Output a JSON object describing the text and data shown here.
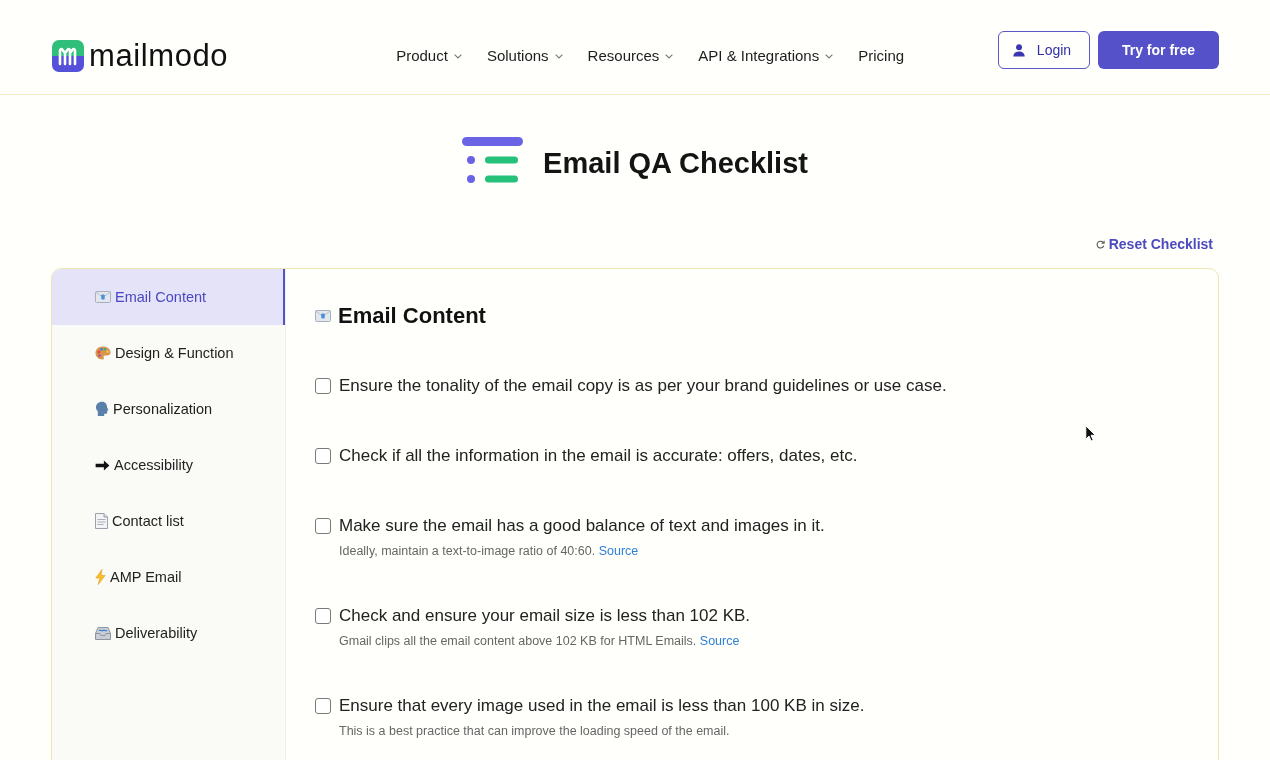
{
  "header": {
    "logo": "mailmodo",
    "nav": [
      {
        "label": "Product",
        "dropdown": true
      },
      {
        "label": "Solutions",
        "dropdown": true
      },
      {
        "label": "Resources",
        "dropdown": true
      },
      {
        "label": "API & Integrations",
        "dropdown": true
      },
      {
        "label": "Pricing",
        "dropdown": false
      }
    ],
    "login_button": "Login",
    "cta_button": "Try for free"
  },
  "page_title": "Email QA Checklist",
  "reset_link": "Reset Checklist",
  "sidebar": {
    "items": [
      {
        "label": "Email Content",
        "selected": true
      },
      {
        "label": "Design & Function",
        "selected": false
      },
      {
        "label": "Personalization",
        "selected": false
      },
      {
        "label": "Accessibility",
        "selected": false
      },
      {
        "label": "Contact list",
        "selected": false
      },
      {
        "label": "AMP Email",
        "selected": false
      },
      {
        "label": "Deliverability",
        "selected": false
      }
    ]
  },
  "section": {
    "heading": "Email Content",
    "items": [
      {
        "text": "Ensure the tonality of the email copy is as per your brand guidelines or use case.",
        "checked": false
      },
      {
        "text": "Check if all the information in the email is accurate: offers, dates, etc.",
        "checked": false
      },
      {
        "text": "Make sure the email has a good balance of text and images in it.",
        "checked": false,
        "note": "Ideally, maintain a text-to-image ratio of 40:60.",
        "note_link": "Source"
      },
      {
        "text": "Check and ensure your email size is less than 102 KB.",
        "checked": false,
        "note": "Gmail clips all the email content above 102 KB for HTML Emails.",
        "note_link": "Source"
      },
      {
        "text": "Ensure that every image used in the email is less than 100 KB in size.",
        "checked": false,
        "note": "This is a best practice that can improve the loading speed of the email."
      }
    ]
  }
}
